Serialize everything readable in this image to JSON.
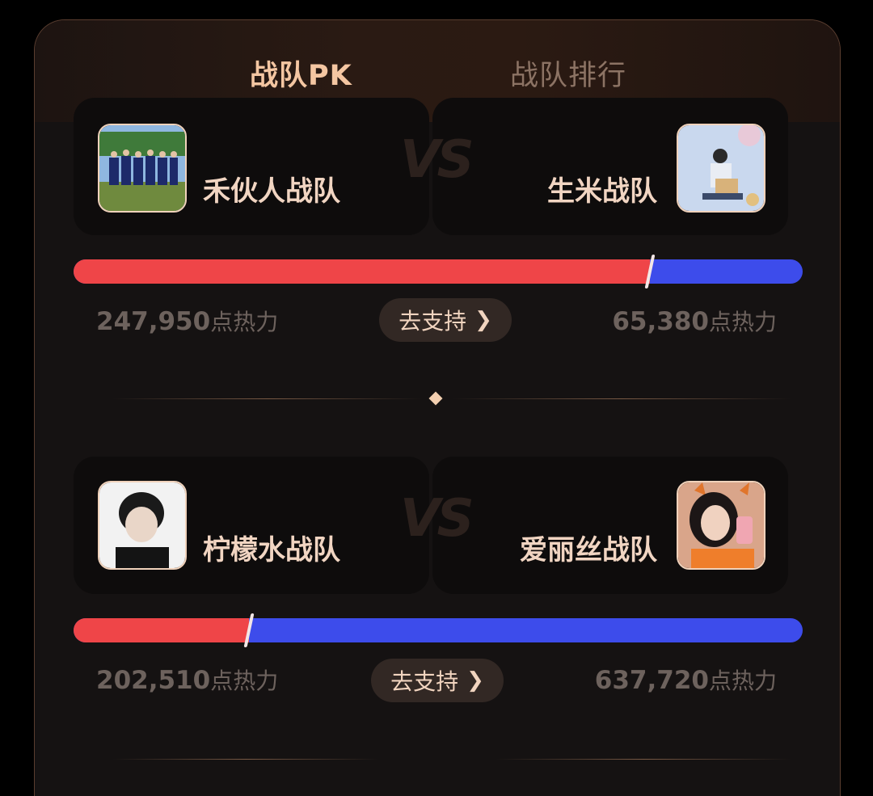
{
  "tabs": [
    {
      "label": "战队PK",
      "active": true
    },
    {
      "label": "战队排行",
      "active": false
    }
  ],
  "vs_text": "VS",
  "matches": [
    {
      "left": {
        "name": "禾伙人战队",
        "score": "247,950",
        "unit": "点热力"
      },
      "right": {
        "name": "生米战队",
        "score": "65,380",
        "unit": "点热力"
      },
      "support_label": "去支持",
      "left_share": 0.791
    },
    {
      "left": {
        "name": "柠檬水战队",
        "score": "202,510",
        "unit": "点热力"
      },
      "right": {
        "name": "爱丽丝战队",
        "score": "637,720",
        "unit": "点热力"
      },
      "support_label": "去支持",
      "left_share": 0.241
    }
  ],
  "colors": {
    "accent": "#f4c6a2",
    "left_bar": "#ef4548",
    "right_bar": "#3d4ceb",
    "panel_bg": "#151212"
  }
}
